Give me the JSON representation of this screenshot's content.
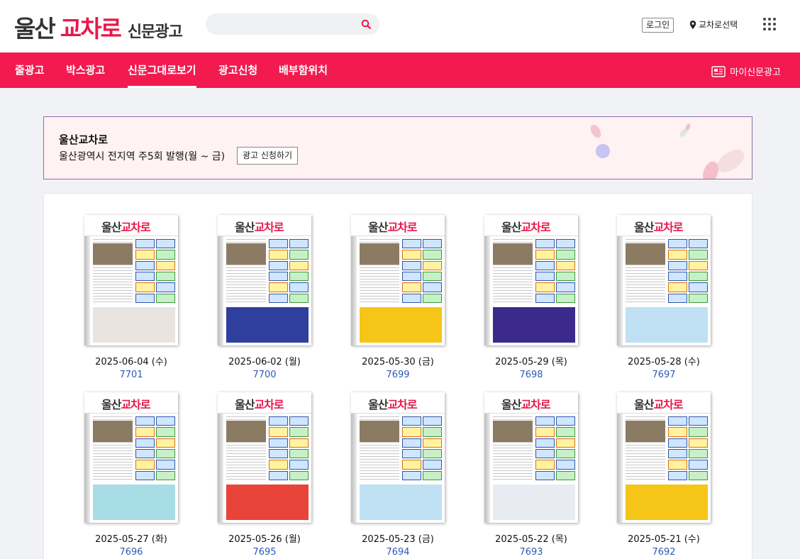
{
  "header": {
    "logo_main": "울산",
    "logo_brand": "교차로",
    "logo_sub": "신문광고",
    "search_placeholder": "",
    "login_label": "로그인",
    "region_label": "교차로선택"
  },
  "nav": {
    "items": [
      {
        "label": "줄광고"
      },
      {
        "label": "박스광고"
      },
      {
        "label": "신문그대로보기",
        "active": true
      },
      {
        "label": "광고신청"
      },
      {
        "label": "배부함위치"
      }
    ],
    "my_ad_label": "마이신문광고"
  },
  "banner": {
    "title": "울산교차로",
    "desc": "울산광역시 전지역 주5회 발행(월 ~ 금)",
    "button_label": "광고 신청하기"
  },
  "issues": [
    {
      "date": "2025-06-04 (수)",
      "number": "7701",
      "bottom_color": "#e9e4df"
    },
    {
      "date": "2025-06-02 (월)",
      "number": "7700",
      "bottom_color": "#2e3f9e"
    },
    {
      "date": "2025-05-30 (금)",
      "number": "7699",
      "bottom_color": "#f5c518"
    },
    {
      "date": "2025-05-29 (목)",
      "number": "7698",
      "bottom_color": "#3b2a8c"
    },
    {
      "date": "2025-05-28 (수)",
      "number": "7697",
      "bottom_color": "#bfe1f3"
    },
    {
      "date": "2025-05-27 (화)",
      "number": "7696",
      "bottom_color": "#a8dde6"
    },
    {
      "date": "2025-05-26 (월)",
      "number": "7695",
      "bottom_color": "#e8443a"
    },
    {
      "date": "2025-05-23 (금)",
      "number": "7694",
      "bottom_color": "#bfe1f3"
    },
    {
      "date": "2025-05-22 (목)",
      "number": "7693",
      "bottom_color": "#e8ecf2"
    },
    {
      "date": "2025-05-21 (수)",
      "number": "7692",
      "bottom_color": "#f5c518"
    }
  ],
  "colors": {
    "brand": "#e8184a",
    "nav_bg": "#f21a4f",
    "issue_number": "#2b59b5"
  },
  "icons": {
    "search": "search-icon",
    "region": "location-pin-icon",
    "apps": "grid-menu-icon",
    "my_ad": "newspaper-icon"
  }
}
